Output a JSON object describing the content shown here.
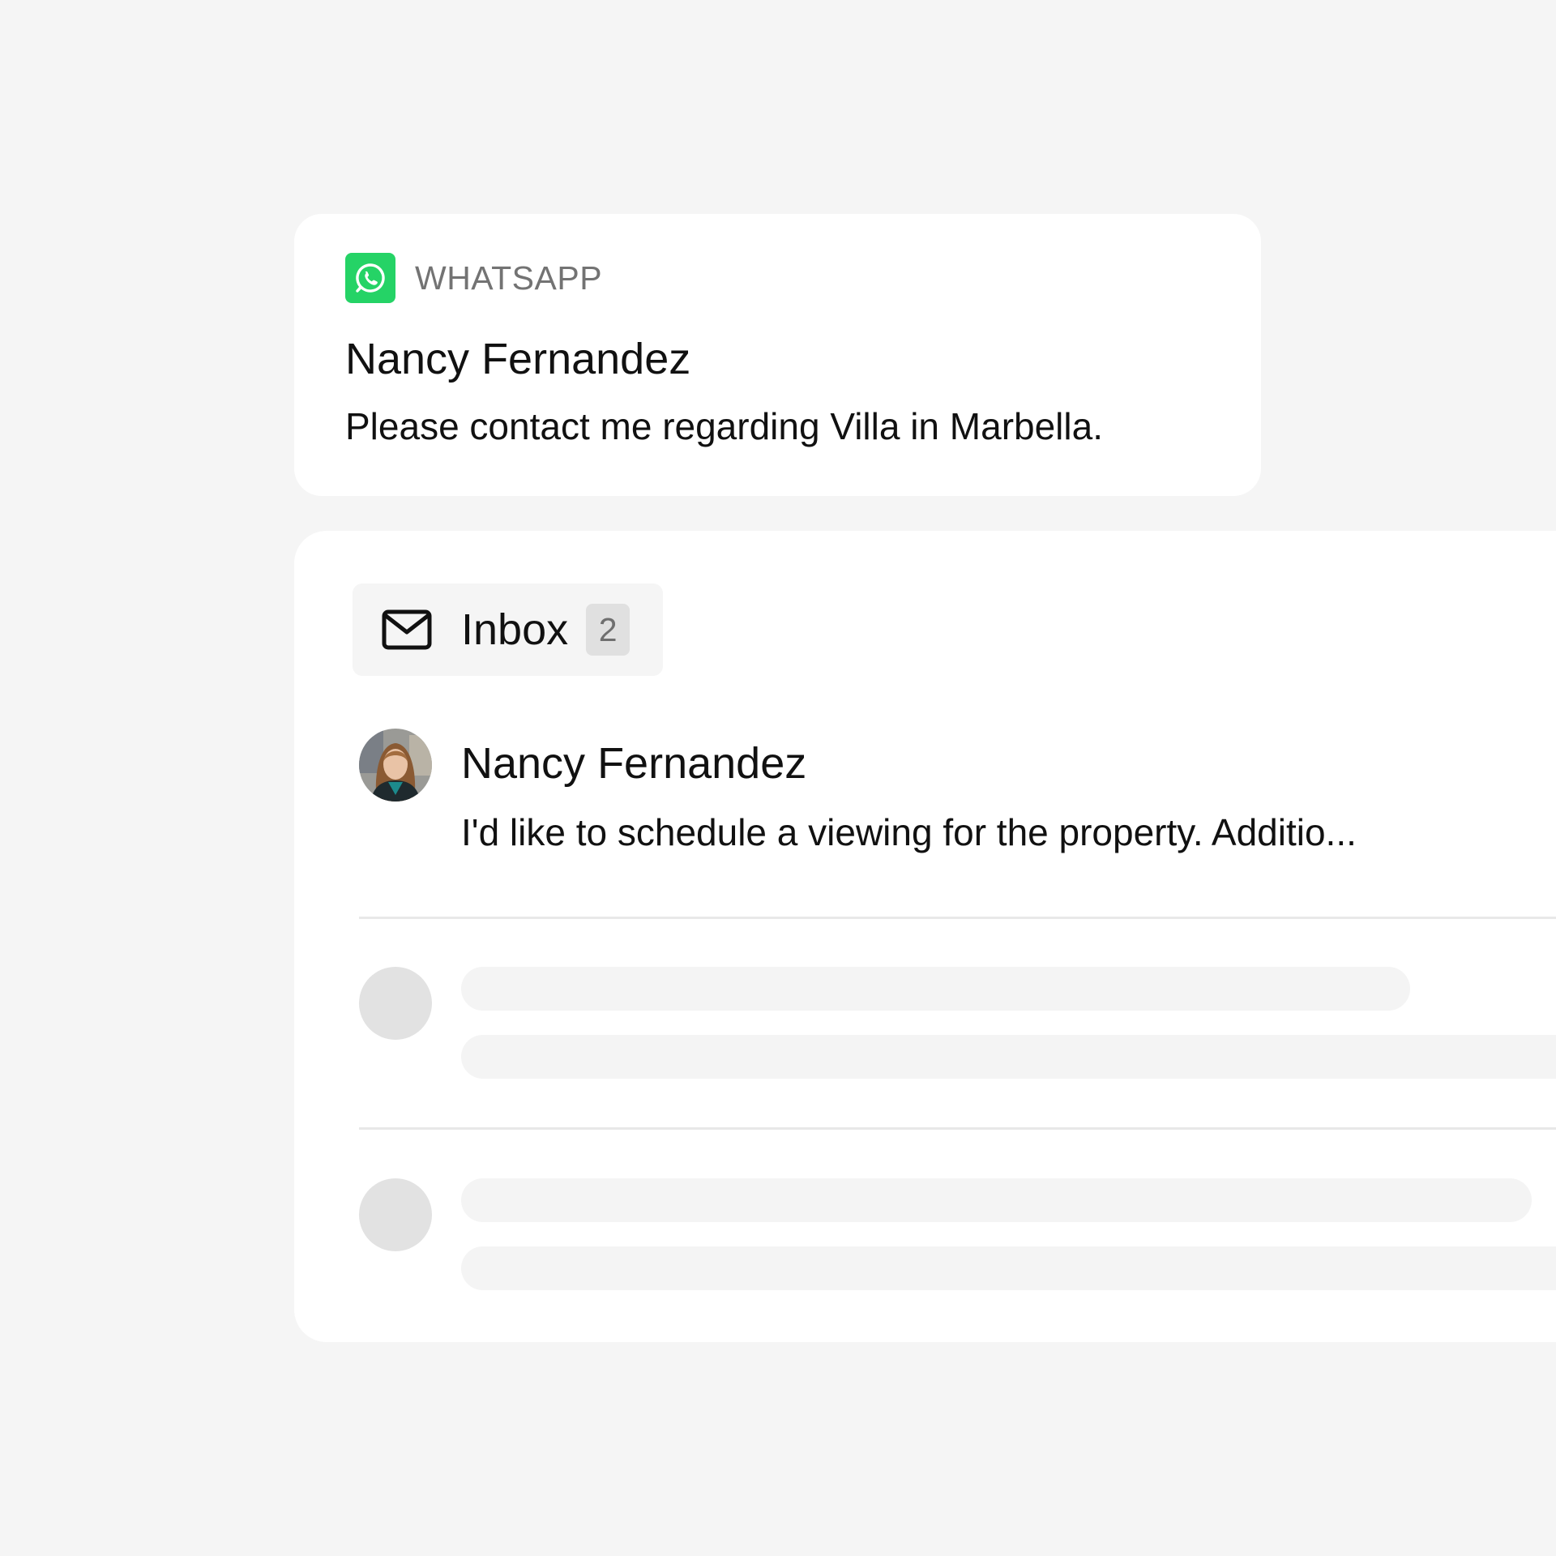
{
  "theme": {
    "whatsapp_green": "#25d366",
    "background": "#f5f5f5",
    "card": "#ffffff"
  },
  "notification": {
    "source_icon": "whatsapp-icon",
    "source": "WHATSAPP",
    "sender": "Nancy Fernandez",
    "message": "Please contact me regarding Villa in Marbella."
  },
  "inbox": {
    "tab_icon": "mail-icon",
    "tab_label": "Inbox",
    "unread_count": "2",
    "messages": [
      {
        "sender": "Nancy Fernandez",
        "preview": "I'd like to schedule a viewing for the property. Additio..."
      }
    ]
  }
}
